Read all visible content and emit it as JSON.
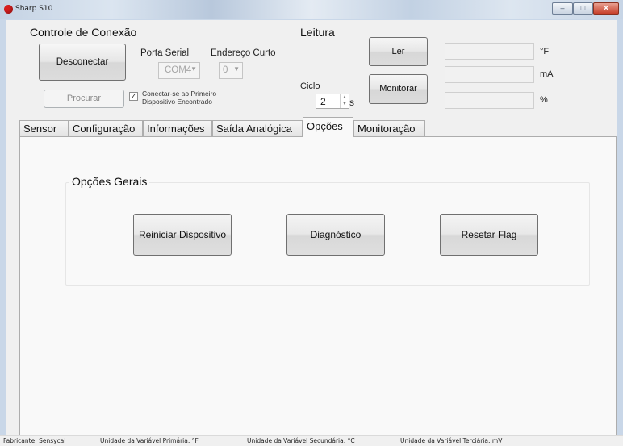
{
  "window": {
    "title": "Sharp S10",
    "caption_buttons": {
      "minimize": "–",
      "maximize": "□",
      "close": "✕"
    }
  },
  "connection": {
    "title": "Controle de Conexão",
    "disconnect_label": "Desconectar",
    "search_label": "Procurar",
    "serial_port_label": "Porta Serial",
    "serial_port_value": "COM4",
    "short_address_label": "Endereço Curto",
    "short_address_value": "0",
    "connect_first_label": "Conectar-se ao Primeiro Dispositivo Encontrado",
    "connect_first_checked": true
  },
  "reading": {
    "title": "Leitura",
    "read_label": "Ler",
    "monitor_label": "Monitorar",
    "cycle_label": "Ciclo",
    "cycle_value": "2",
    "cycle_unit": "s",
    "units": [
      "°F",
      "mA",
      "%"
    ],
    "values": [
      "",
      "",
      ""
    ]
  },
  "tabs": [
    {
      "label": "Sensor"
    },
    {
      "label": "Configuração"
    },
    {
      "label": "Informações"
    },
    {
      "label": "Saída Analógica"
    },
    {
      "label": "Opções",
      "active": true
    },
    {
      "label": "Monitoração"
    }
  ],
  "options": {
    "group_title": "Opções Gerais",
    "restart_label": "Reiniciar Dispositivo",
    "diagnostic_label": "Diagnóstico",
    "reset_flag_label": "Resetar Flag"
  },
  "statusbar": {
    "manufacturer": "Fabricante: Sensycal",
    "primary_unit": "Unidade da Variável Primária: °F",
    "secondary_unit": "Unidade da Variável Secundária: °C",
    "tertiary_unit": "Unidade da Variável Terciária: mV"
  },
  "colors": {
    "app_icon": "#d81e1e",
    "close_button": "#c73f2a",
    "titlebar": "#c9d7e8",
    "client_background": "#f0f0f0"
  }
}
